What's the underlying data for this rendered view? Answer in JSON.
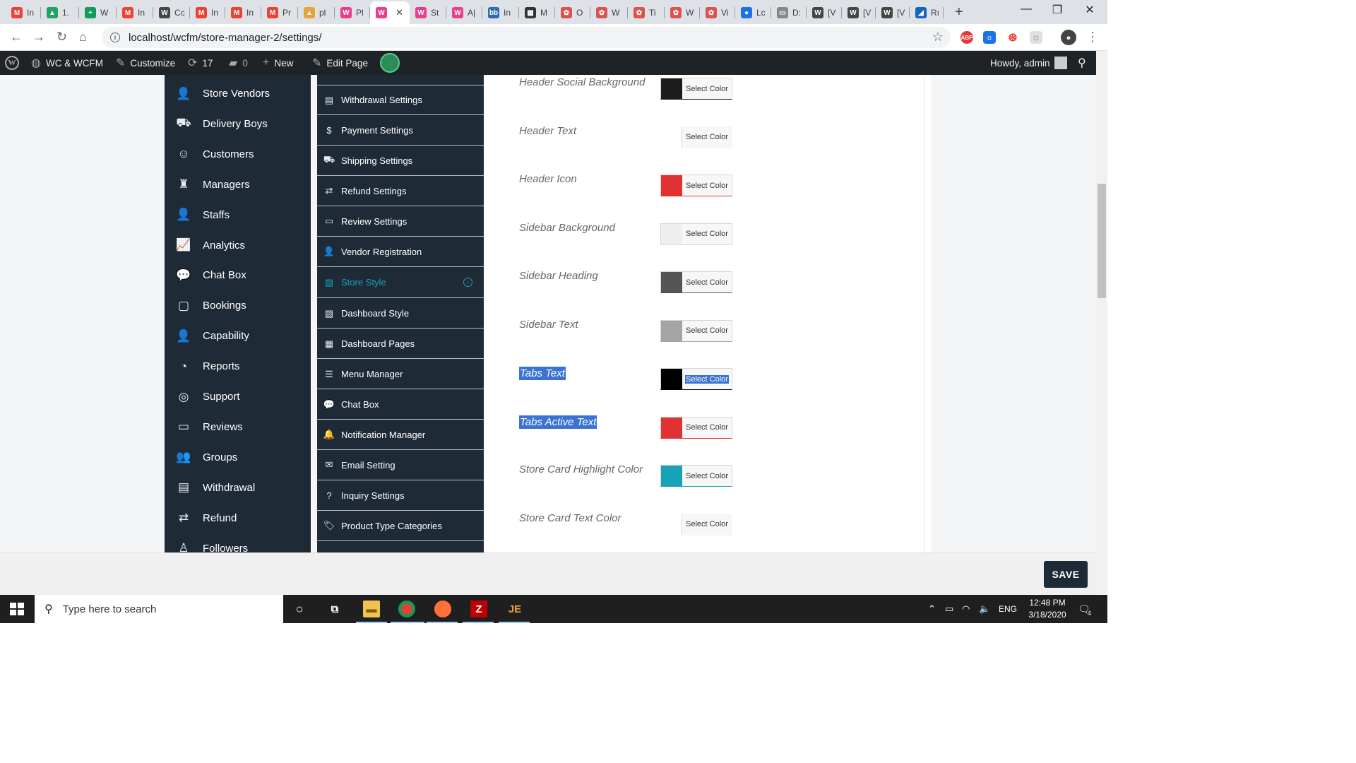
{
  "browser": {
    "tabs": [
      {
        "label": "In",
        "fav": "M",
        "color": "#ea4335",
        "icon": "gmail-icon"
      },
      {
        "label": "1.",
        "fav": "▲",
        "color": "#1fa463",
        "icon": "drive-icon"
      },
      {
        "label": "W",
        "fav": "+",
        "color": "#0f9d58",
        "icon": "sheets-icon"
      },
      {
        "label": "In",
        "fav": "M",
        "color": "#ea4335",
        "icon": "gmail-icon"
      },
      {
        "label": "Cc",
        "fav": "W",
        "color": "#464646",
        "icon": "wordpress-icon"
      },
      {
        "label": "In",
        "fav": "M",
        "color": "#ea4335",
        "icon": "gmail-icon"
      },
      {
        "label": "In",
        "fav": "M",
        "color": "#ea4335",
        "icon": "gmail-icon"
      },
      {
        "label": "Pr",
        "fav": "M",
        "color": "#ea4335",
        "icon": "gmail-icon"
      },
      {
        "label": "pl",
        "fav": "▲",
        "color": "#e8a23b",
        "icon": "pma-icon"
      },
      {
        "label": "Pl",
        "fav": "W",
        "color": "#e83e8c",
        "icon": "wcfm-icon"
      },
      {
        "label": "",
        "fav": "W",
        "color": "#e83e8c",
        "icon": "wcfm-icon",
        "active": true
      },
      {
        "label": "St",
        "fav": "W",
        "color": "#e83e8c",
        "icon": "wcfm-icon"
      },
      {
        "label": "A|",
        "fav": "W",
        "color": "#e83e8c",
        "icon": "wcfm-icon"
      },
      {
        "label": "In",
        "fav": "bb",
        "color": "#2b6cb0",
        "icon": "imgbb-icon"
      },
      {
        "label": "M",
        "fav": "▦",
        "color": "#333333",
        "icon": "grid-icon"
      },
      {
        "label": "O",
        "fav": "✿",
        "color": "#d9534f",
        "icon": "flower-icon"
      },
      {
        "label": "W",
        "fav": "✿",
        "color": "#d9534f",
        "icon": "flower-icon"
      },
      {
        "label": "Ti",
        "fav": "✿",
        "color": "#d9534f",
        "icon": "flower-icon"
      },
      {
        "label": "W",
        "fav": "✿",
        "color": "#d9534f",
        "icon": "flower-icon"
      },
      {
        "label": "Vi",
        "fav": "✿",
        "color": "#d9534f",
        "icon": "flower-icon"
      },
      {
        "label": "Lc",
        "fav": "●",
        "color": "#1a73e8",
        "icon": "globe-icon"
      },
      {
        "label": "D:",
        "fav": "▭",
        "color": "#888888",
        "icon": "page-icon"
      },
      {
        "label": "[V",
        "fav": "W",
        "color": "#464646",
        "icon": "wordpress-icon"
      },
      {
        "label": "[V",
        "fav": "W",
        "color": "#464646",
        "icon": "wordpress-icon"
      },
      {
        "label": "[V",
        "fav": "W",
        "color": "#464646",
        "icon": "wordpress-icon"
      },
      {
        "label": "Rı",
        "fav": "◢",
        "color": "#1565c0",
        "icon": "feather-icon"
      }
    ],
    "url": "localhost/wcfm/store-manager-2/settings/"
  },
  "adminbar": {
    "site": "WC & WCFM",
    "customize": "Customize",
    "updates": "17",
    "comments": "0",
    "new": "New",
    "edit": "Edit Page",
    "howdy": "Howdy, admin"
  },
  "leftmenu": [
    {
      "label": "Store Vendors",
      "icon": "user-icon",
      "glyph": "👤"
    },
    {
      "label": "Delivery Boys",
      "icon": "truck-icon",
      "glyph": "⛟"
    },
    {
      "label": "Customers",
      "icon": "user-circle-icon",
      "glyph": "☺"
    },
    {
      "label": "Managers",
      "icon": "manager-icon",
      "glyph": "♜"
    },
    {
      "label": "Staffs",
      "icon": "user-icon",
      "glyph": "👤"
    },
    {
      "label": "Analytics",
      "icon": "chart-line-icon",
      "glyph": "📈"
    },
    {
      "label": "Chat Box",
      "icon": "comments-icon",
      "glyph": "💬"
    },
    {
      "label": "Bookings",
      "icon": "calendar-icon",
      "glyph": "▢"
    },
    {
      "label": "Capability",
      "icon": "user-times-icon",
      "glyph": "👤"
    },
    {
      "label": "Reports",
      "icon": "pie-chart-icon",
      "glyph": "◔"
    },
    {
      "label": "Support",
      "icon": "life-ring-icon",
      "glyph": "◎"
    },
    {
      "label": "Reviews",
      "icon": "comment-icon",
      "glyph": "▭"
    },
    {
      "label": "Groups",
      "icon": "users-icon",
      "glyph": "👥"
    },
    {
      "label": "Withdrawal",
      "icon": "credit-card-icon",
      "glyph": "▤"
    },
    {
      "label": "Refund",
      "icon": "retweet-icon",
      "glyph": "⇄"
    },
    {
      "label": "Followers",
      "icon": "child-icon",
      "glyph": "♙"
    }
  ],
  "settingsmenu": [
    {
      "label": "Withdrawal Settings",
      "icon": "credit-card-icon",
      "glyph": "▤"
    },
    {
      "label": "Payment Settings",
      "icon": "dollar-icon",
      "glyph": "$"
    },
    {
      "label": "Shipping Settings",
      "icon": "truck-icon",
      "glyph": "⛟"
    },
    {
      "label": "Refund Settings",
      "icon": "retweet-icon",
      "glyph": "⇄"
    },
    {
      "label": "Review Settings",
      "icon": "comment-icon",
      "glyph": "▭"
    },
    {
      "label": "Vendor Registration",
      "icon": "user-icon",
      "glyph": "👤"
    },
    {
      "label": "Store Style",
      "icon": "image-icon",
      "glyph": "▨",
      "active": true
    },
    {
      "label": "Dashboard Style",
      "icon": "image-icon",
      "glyph": "▨"
    },
    {
      "label": "Dashboard Pages",
      "icon": "newspaper-icon",
      "glyph": "▦"
    },
    {
      "label": "Menu Manager",
      "icon": "list-icon",
      "glyph": "☰"
    },
    {
      "label": "Chat Box",
      "icon": "comments-icon",
      "glyph": "💬"
    },
    {
      "label": "Notification Manager",
      "icon": "bell-icon",
      "glyph": "🔔"
    },
    {
      "label": "Email Setting",
      "icon": "envelope-icon",
      "glyph": "✉"
    },
    {
      "label": "Inquiry Settings",
      "icon": "question-circle-icon",
      "glyph": "?"
    },
    {
      "label": "Product Type Categories",
      "icon": "tags-icon",
      "glyph": "🏷"
    }
  ],
  "colorrows": [
    {
      "label": "Header Social Background",
      "color": "#1c1c1c",
      "btn": "Select Color"
    },
    {
      "label": "Header Text",
      "color": null,
      "btn": "Select Color"
    },
    {
      "label": "Header Icon",
      "color": "#e03232",
      "btn": "Select Color"
    },
    {
      "label": "Sidebar Background",
      "color": "#eeeeee",
      "btn": "Select Color"
    },
    {
      "label": "Sidebar Heading",
      "color": "#555555",
      "btn": "Select Color"
    },
    {
      "label": "Sidebar Text",
      "color": "#a4a4a4",
      "btn": "Select Color"
    },
    {
      "label": "Tabs Text",
      "color": "#000000",
      "btn": "Select Color",
      "highlight": true,
      "btnHighlight": true
    },
    {
      "label": "Tabs Active Text",
      "color": "#e03232",
      "btn": "Select Color",
      "highlight": true
    },
    {
      "label": "Store Card Highlight Color",
      "color": "#17a2b8",
      "btn": "Select Color"
    },
    {
      "label": "Store Card Text Color",
      "color": null,
      "btn": "Select Color"
    }
  ],
  "save": "SAVE",
  "taskbar": {
    "search_placeholder": "Type here to search",
    "lang": "ENG",
    "time": "12:48 PM",
    "date": "3/18/2020",
    "notifications": "4"
  },
  "colors": {
    "sidebar": "#1e2b37",
    "accent": "#17a2b8",
    "adminbar": "#1d2327"
  }
}
